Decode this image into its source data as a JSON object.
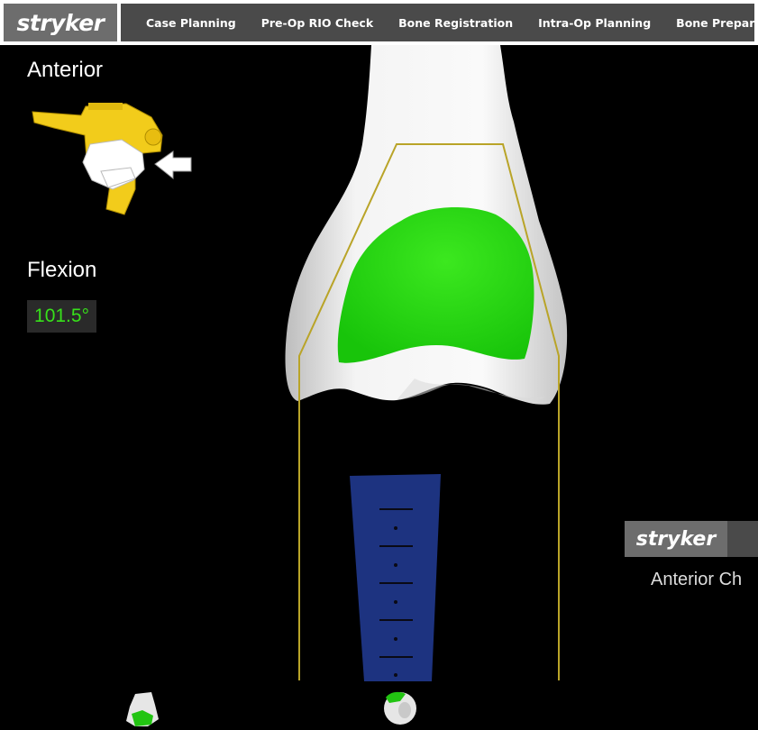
{
  "header": {
    "logo": "stryker",
    "tabs": [
      {
        "label": "Case Planning"
      },
      {
        "label": "Pre-Op RIO Check"
      },
      {
        "label": "Bone Registration"
      },
      {
        "label": "Intra-Op Planning"
      },
      {
        "label": "Bone Preparation"
      }
    ]
  },
  "view": {
    "label": "Anterior",
    "flexion_label": "Flexion",
    "flexion_value": "101.5°"
  },
  "icons": {
    "handpiece": "robotic-handpiece-icon",
    "arrow": "pointer-arrow-icon",
    "femur_thumb": "femur-thumbnail-icon",
    "tibia_thumb": "tibia-thumbnail-icon"
  },
  "colors": {
    "resection": "#1fd40f",
    "implant_outline": "#b9a428",
    "tibial_guide": "#1d3380",
    "handpiece": "#f2cc1b",
    "flexion_value": "#37e01a"
  },
  "overlay": {
    "logo": "stryker",
    "title": "Anterior Ch"
  }
}
